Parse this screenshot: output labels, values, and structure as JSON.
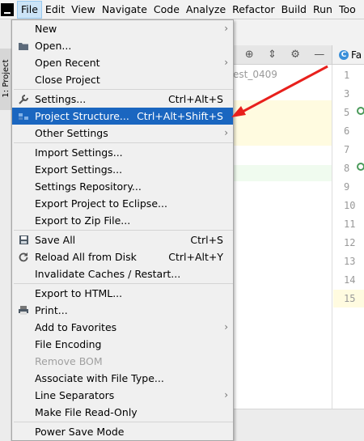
{
  "menubar": {
    "items": [
      "File",
      "Edit",
      "View",
      "Navigate",
      "Code",
      "Analyze",
      "Refactor",
      "Build",
      "Run",
      "Too"
    ],
    "active": "File"
  },
  "side_panel": {
    "tab_label": "1: Project",
    "breadcrumb": "est_0409"
  },
  "editor": {
    "tab_label": "Fa",
    "line_numbers": [
      "1",
      "3",
      "5",
      "6",
      "7",
      "8",
      "9",
      "10",
      "11",
      "12",
      "13",
      "14",
      "15"
    ]
  },
  "file_menu": {
    "items": [
      {
        "label": "New",
        "shortcut": "",
        "submenu": true,
        "icon": ""
      },
      {
        "label": "Open...",
        "shortcut": "",
        "submenu": false,
        "icon": "folder-icon"
      },
      {
        "label": "Open Recent",
        "shortcut": "",
        "submenu": true,
        "icon": ""
      },
      {
        "label": "Close Project",
        "shortcut": "",
        "submenu": false,
        "icon": ""
      },
      {
        "sep": true
      },
      {
        "label": "Settings...",
        "shortcut": "Ctrl+Alt+S",
        "submenu": false,
        "icon": "wrench-icon"
      },
      {
        "label": "Project Structure...",
        "shortcut": "Ctrl+Alt+Shift+S",
        "submenu": false,
        "icon": "project-structure-icon",
        "highlighted": true
      },
      {
        "label": "Other Settings",
        "shortcut": "",
        "submenu": true,
        "icon": ""
      },
      {
        "sep": true
      },
      {
        "label": "Import Settings...",
        "shortcut": "",
        "submenu": false,
        "icon": ""
      },
      {
        "label": "Export Settings...",
        "shortcut": "",
        "submenu": false,
        "icon": ""
      },
      {
        "label": "Settings Repository...",
        "shortcut": "",
        "submenu": false,
        "icon": ""
      },
      {
        "label": "Export Project to Eclipse...",
        "shortcut": "",
        "submenu": false,
        "icon": ""
      },
      {
        "label": "Export to Zip File...",
        "shortcut": "",
        "submenu": false,
        "icon": ""
      },
      {
        "sep": true
      },
      {
        "label": "Save All",
        "shortcut": "Ctrl+S",
        "submenu": false,
        "icon": "save-icon"
      },
      {
        "label": "Reload All from Disk",
        "shortcut": "Ctrl+Alt+Y",
        "submenu": false,
        "icon": "reload-icon"
      },
      {
        "label": "Invalidate Caches / Restart...",
        "shortcut": "",
        "submenu": false,
        "icon": ""
      },
      {
        "sep": true
      },
      {
        "label": "Export to HTML...",
        "shortcut": "",
        "submenu": false,
        "icon": ""
      },
      {
        "label": "Print...",
        "shortcut": "",
        "submenu": false,
        "icon": "print-icon"
      },
      {
        "label": "Add to Favorites",
        "shortcut": "",
        "submenu": true,
        "icon": ""
      },
      {
        "label": "File Encoding",
        "shortcut": "",
        "submenu": false,
        "icon": ""
      },
      {
        "label": "Remove BOM",
        "shortcut": "",
        "submenu": false,
        "icon": "",
        "disabled": true
      },
      {
        "label": "Associate with File Type...",
        "shortcut": "",
        "submenu": false,
        "icon": ""
      },
      {
        "label": "Line Separators",
        "shortcut": "",
        "submenu": true,
        "icon": ""
      },
      {
        "label": "Make File Read-Only",
        "shortcut": "",
        "submenu": false,
        "icon": ""
      },
      {
        "sep": true
      },
      {
        "label": "Power Save Mode",
        "shortcut": "",
        "submenu": false,
        "icon": ""
      }
    ]
  },
  "colors": {
    "highlight": "#1a66c0",
    "annotation_arrow": "#e8201c"
  }
}
